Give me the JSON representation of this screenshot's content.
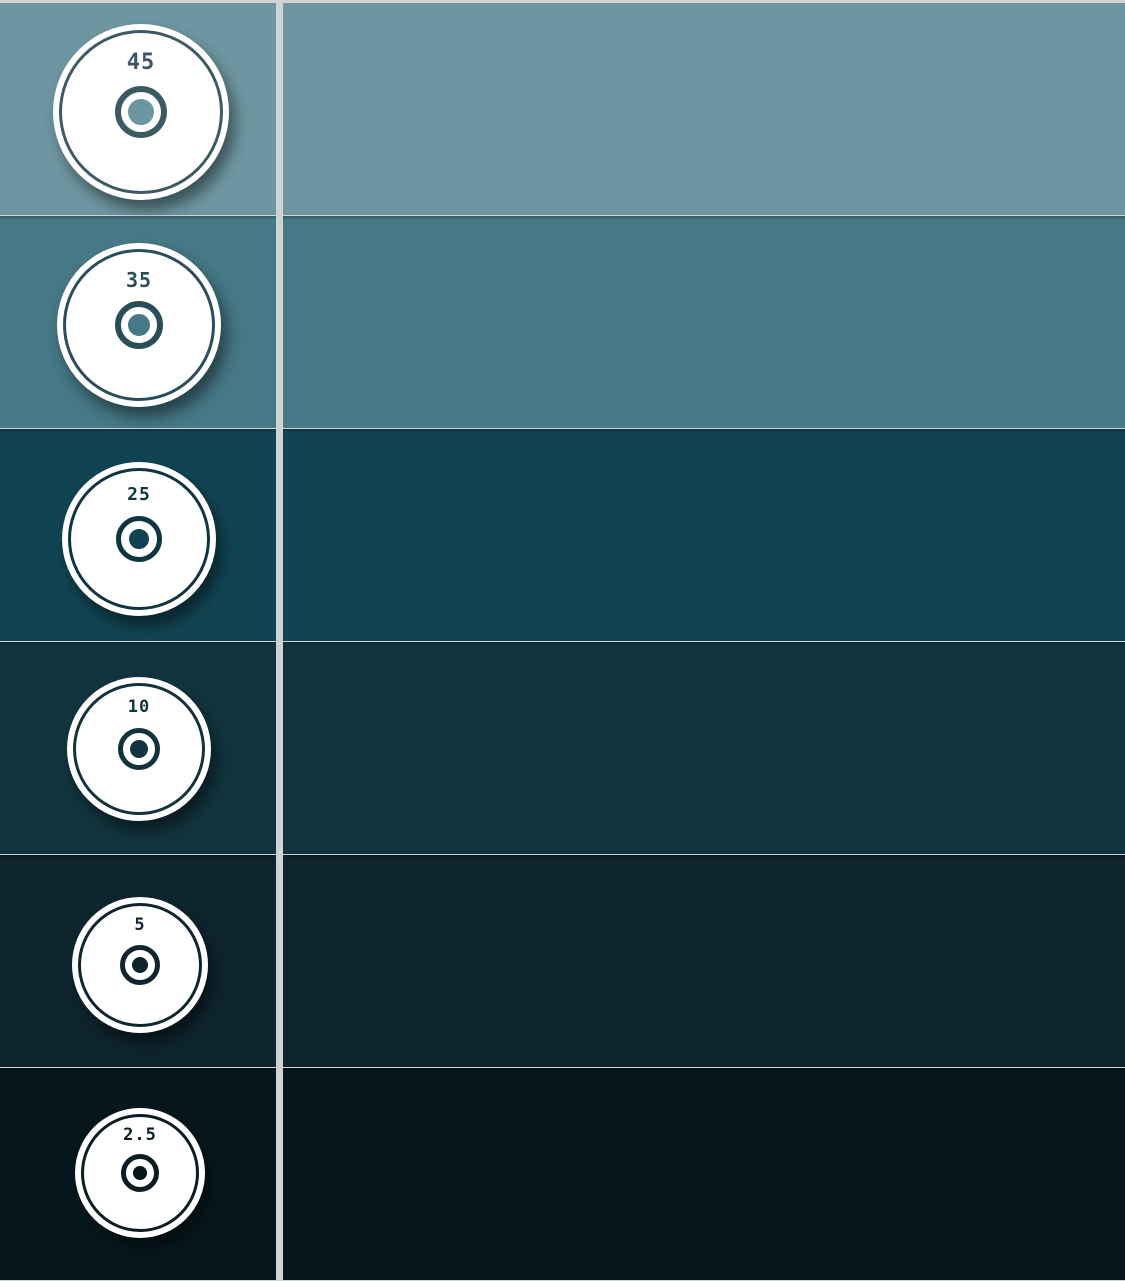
{
  "plates": [
    {
      "weight": "45",
      "row_color": "#6e96a0",
      "ink_color": "#3d5a64"
    },
    {
      "weight": "35",
      "row_color": "#467885",
      "ink_color": "#2a4e59"
    },
    {
      "weight": "25",
      "row_color": "#114452",
      "ink_color": "#0f3541"
    },
    {
      "weight": "10",
      "row_color": "#12343e",
      "ink_color": "#12323c"
    },
    {
      "weight": "5",
      "row_color": "#0e252e",
      "ink_color": "#0f2630"
    },
    {
      "weight": "2.5",
      "row_color": "#06181d",
      "ink_color": "#0b1d23"
    }
  ],
  "colors": {
    "separator": "#cfd3d4",
    "plate_fill": "#ffffff"
  }
}
